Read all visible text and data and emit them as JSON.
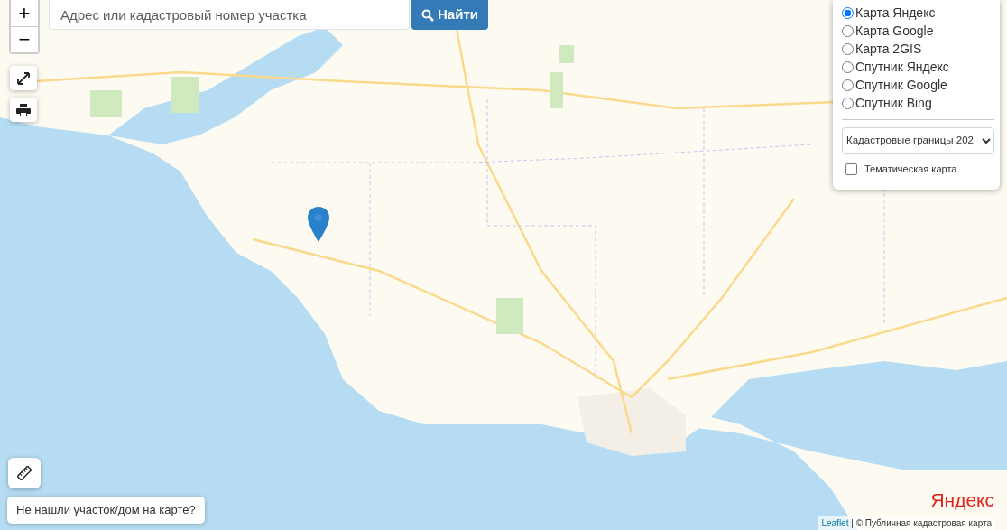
{
  "zoom": {
    "in": "+",
    "out": "−"
  },
  "search": {
    "placeholder": "Адрес или кадастровый номер участка",
    "button": "Найти"
  },
  "layers": [
    {
      "label": "Карта Яндекс",
      "selected": true
    },
    {
      "label": "Карта Google",
      "selected": false
    },
    {
      "label": "Карта 2GIS",
      "selected": false
    },
    {
      "label": "Спутник Яндекс",
      "selected": false
    },
    {
      "label": "Спутник Google",
      "selected": false
    },
    {
      "label": "Спутник Bing",
      "selected": false
    }
  ],
  "overlay_select": {
    "value": "Кадастровые границы 202"
  },
  "thematic": {
    "label": "Тематическая карта",
    "checked": false
  },
  "not_found_button": "Не нашли участок/дом на карте?",
  "map_logo": "Яндекс",
  "attribution": {
    "link": "Leaflet",
    "separator": "|",
    "text": "© Публичная кадастровая карта"
  }
}
